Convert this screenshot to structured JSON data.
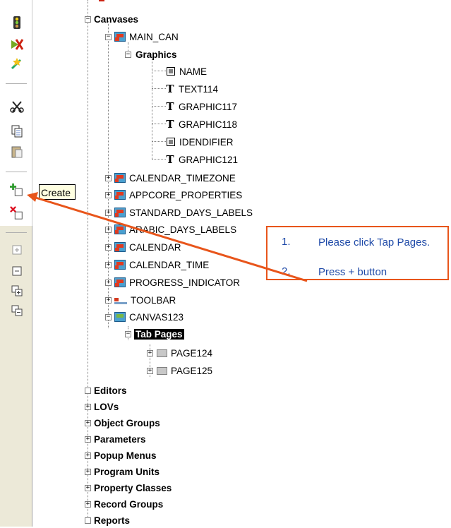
{
  "toolbar": {
    "icons": [
      "traffic-light-icon",
      "run-debug-icon",
      "compile-icon",
      "cut-icon",
      "copy-icon",
      "paste-icon",
      "create-icon",
      "delete-icon",
      "expand-icon",
      "collapse-icon",
      "expand-all-icon",
      "collapse-all-icon"
    ],
    "tooltip": "Create"
  },
  "tree": {
    "canvases": "Canvases",
    "main_can": "MAIN_CAN",
    "graphics": "Graphics",
    "graphics_items": [
      "NAME",
      "TEXT114",
      "GRAPHIC117",
      "GRAPHIC118",
      "IDENDIFIER",
      "GRAPHIC121"
    ],
    "canvas_items": [
      "CALENDAR_TIMEZONE",
      "APPCORE_PROPERTIES",
      "STANDARD_DAYS_LABELS",
      "ARABIC_DAYS_LABELS",
      "CALENDAR",
      "CALENDAR_TIME",
      "PROGRESS_INDICATOR",
      "TOOLBAR"
    ],
    "canvas123": "CANVAS123",
    "tab_pages": "Tab Pages",
    "pages": [
      "PAGE124",
      "PAGE125"
    ],
    "sections": [
      "Editors",
      "LOVs",
      "Object Groups",
      "Parameters",
      "Popup Menus",
      "Program Units",
      "Property Classes",
      "Record Groups",
      "Reports"
    ]
  },
  "callout": {
    "step1_num": "1.",
    "step1_text": "Please click Tap Pages.",
    "step2_num": "2.",
    "step2_text": "Press + button",
    "border_color": "#e8551b",
    "text_color": "#1f4aa8"
  },
  "arrow_color": "#e8551b"
}
